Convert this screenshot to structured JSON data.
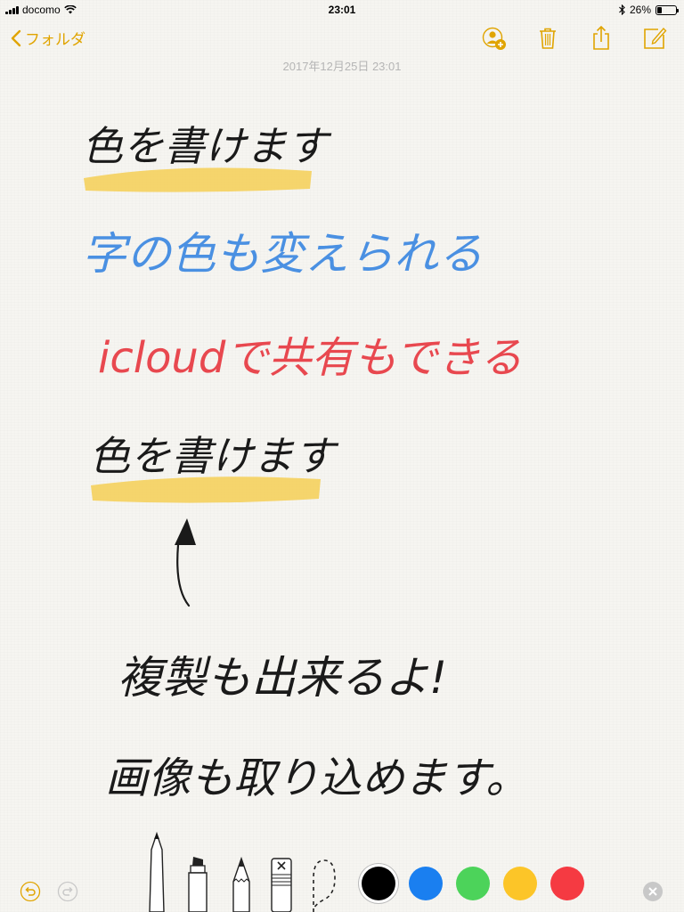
{
  "status_bar": {
    "carrier": "docomo",
    "time": "23:01",
    "battery_percent": "26%",
    "battery_level": 0.26
  },
  "nav": {
    "back_label": "フォルダ",
    "icons": [
      "add-person-icon",
      "trash-icon",
      "share-icon",
      "compose-icon"
    ]
  },
  "note": {
    "timestamp": "2017年12月25日 23:01",
    "lines": [
      {
        "text": "色を書けます",
        "color": "#1a1a1a",
        "highlight": "#f5cf55"
      },
      {
        "text": "字の色も変えられる",
        "color": "#4a90e2"
      },
      {
        "text": "icloudで共有もできる",
        "color": "#e8484f"
      },
      {
        "text": "色を書けます",
        "color": "#1a1a1a",
        "highlight": "#f5cf55"
      },
      {
        "text": "複製も出来るよ!",
        "color": "#1a1a1a"
      },
      {
        "text": "画像も取り込めます。",
        "color": "#1a1a1a"
      }
    ]
  },
  "toolbar": {
    "tools": [
      "pen-icon",
      "marker-icon",
      "pencil-icon",
      "eraser-icon",
      "lasso-icon"
    ],
    "colors": [
      {
        "name": "black",
        "hex": "#000000",
        "selected": true
      },
      {
        "name": "blue",
        "hex": "#1a7ff0",
        "selected": false
      },
      {
        "name": "green",
        "hex": "#4cd35a",
        "selected": false
      },
      {
        "name": "yellow",
        "hex": "#fcc528",
        "selected": false
      },
      {
        "name": "red",
        "hex": "#f53a42",
        "selected": false
      }
    ],
    "accent": "#e0a400"
  }
}
